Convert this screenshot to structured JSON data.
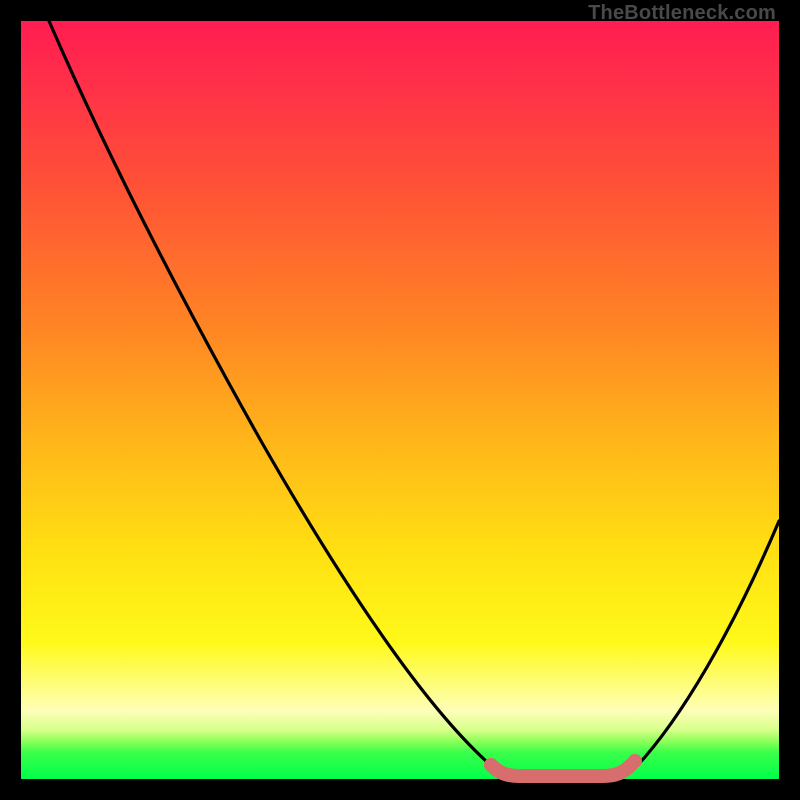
{
  "watermark": "TheBottleneck.com",
  "chart_data": {
    "type": "line",
    "title": "",
    "xlabel": "",
    "ylabel": "",
    "xlim": [
      0,
      100
    ],
    "ylim": [
      0,
      100
    ],
    "grid": false,
    "legend": false,
    "description": "Bottleneck curve with single minimum. Black curve descends steeply from top-left to a flat valley at bottom, then rises toward the right. Salmon-colored marker segment highlights the flat optimal region at the valley floor.",
    "series": [
      {
        "name": "bottleneck-curve",
        "color": "#000000",
        "x": [
          5,
          10,
          15,
          20,
          25,
          30,
          35,
          40,
          45,
          50,
          55,
          60,
          63,
          66,
          69,
          72,
          76,
          80,
          84,
          88,
          92,
          96,
          100
        ],
        "y": [
          100,
          92,
          84,
          76,
          68,
          60,
          52,
          44,
          36,
          28,
          20,
          12,
          6,
          2,
          0.3,
          0.1,
          0.2,
          1,
          5,
          12,
          21,
          32,
          45
        ]
      },
      {
        "name": "optimal-region",
        "color": "#d76b6b",
        "x": [
          63,
          66,
          69,
          72,
          76,
          79
        ],
        "y": [
          1.2,
          0.5,
          0.3,
          0.3,
          0.5,
          1.2
        ]
      }
    ]
  }
}
